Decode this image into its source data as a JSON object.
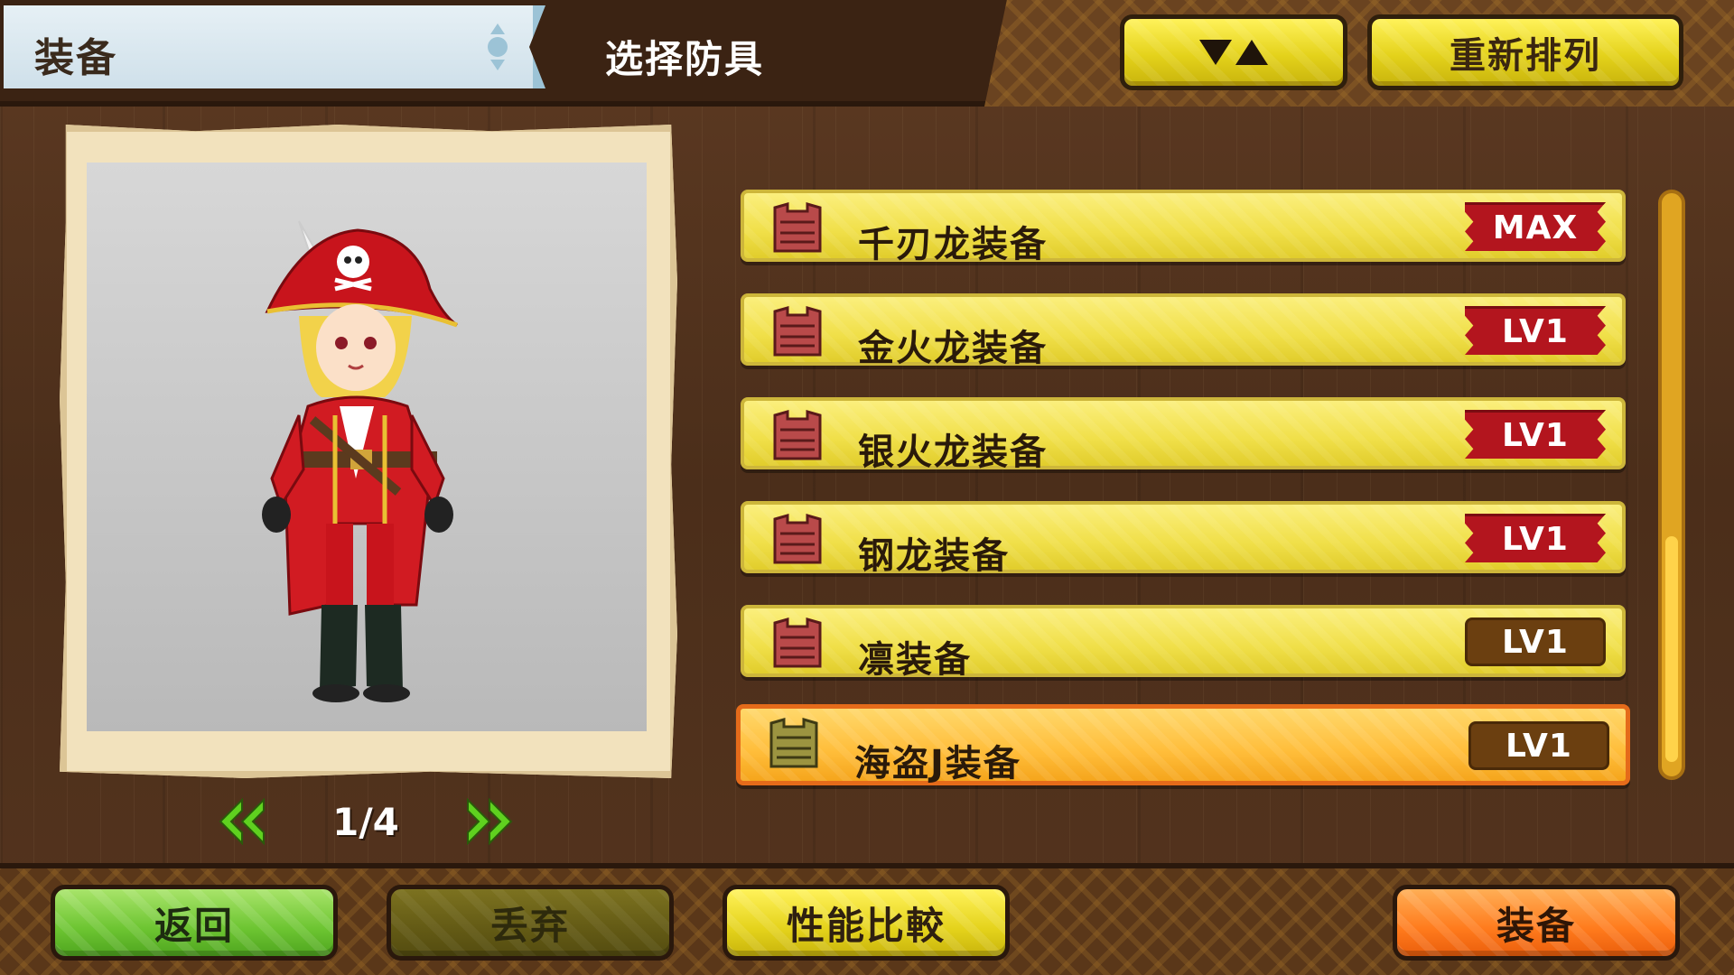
{
  "header": {
    "title": "装备",
    "subtitle": "选择防具",
    "sort_icon": "sort-toggle-icon",
    "resort_label": "重新排列"
  },
  "preview": {
    "page": "1/4",
    "prev_icon": "double-chevron-left-icon",
    "next_icon": "double-chevron-right-icon"
  },
  "armor_list": {
    "items": [
      {
        "name": "千刃龙装备",
        "level": "MAX",
        "badge_style": "red",
        "selected": false
      },
      {
        "name": "金火龙装备",
        "level": "LV1",
        "badge_style": "red",
        "selected": false
      },
      {
        "name": "银火龙装备",
        "level": "LV1",
        "badge_style": "red",
        "selected": false
      },
      {
        "name": "钢龙装备",
        "level": "LV1",
        "badge_style": "red",
        "selected": false
      },
      {
        "name": "凛装备",
        "level": "LV1",
        "badge_style": "brown",
        "selected": false
      },
      {
        "name": "海盗J装备",
        "level": "LV1",
        "badge_style": "brown",
        "selected": true
      }
    ],
    "scroll_position": 0.62
  },
  "footer": {
    "back_label": "返回",
    "discard_label": "丢弃",
    "compare_label": "性能比較",
    "equip_label": "装备"
  },
  "colors": {
    "wood_bg": "#4b2e1a",
    "item_yellow": "#f0df48",
    "item_selected": "#ffbd3a",
    "badge_red": "#b3151e",
    "badge_brown": "#6b3f10",
    "armor_icon_red": "#b94a4a",
    "armor_icon_olive": "#9c9440",
    "pager_green": "#5fd11f"
  }
}
